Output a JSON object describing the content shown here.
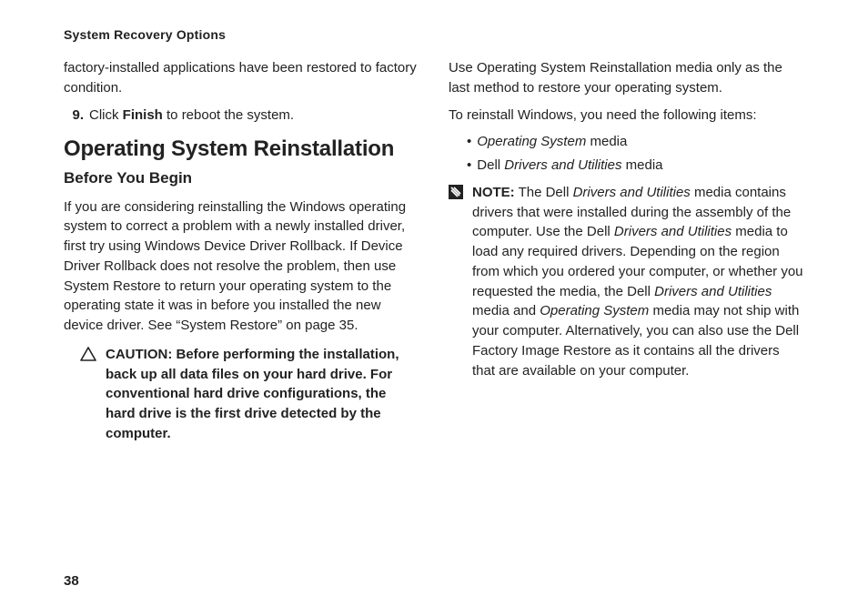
{
  "header": "System Recovery Options",
  "left": {
    "continued_text": "factory-installed applications have been restored to factory condition.",
    "step_number": "9.",
    "step_text_before": "Click ",
    "step_text_bold": "Finish",
    "step_text_after": " to reboot the system.",
    "h2": "Operating System Reinstallation",
    "h3": "Before You Begin",
    "para1": "If you are considering reinstalling the Windows operating system to correct a problem with a newly installed driver, first try using Windows Device Driver Rollback. If Device Driver Rollback does not resolve the problem, then use System Restore to return your operating system to the operating state it was in before you installed the new device driver. See “System Restore” on page 35.",
    "caution_text": "CAUTION: Before performing the installation, back up all data files on your hard drive. For conventional hard drive configurations, the hard drive is the first drive detected by the computer."
  },
  "right": {
    "para1": "Use Operating System Reinstallation media only as the last method to restore your operating system.",
    "para2": "To reinstall Windows, you need the following items:",
    "bullet1_italic": "Operating System",
    "bullet1_after": " media",
    "bullet2_before": "Dell ",
    "bullet2_italic": "Drivers and Utilities",
    "bullet2_after": " media",
    "note_label": "NOTE:",
    "note_s1_before": " The Dell ",
    "note_s1_italic": "Drivers and Utilities",
    "note_s1_after": " media contains drivers that were installed during the assembly of the computer. Use the Dell ",
    "note_s2_italic": "Drivers and Utilities",
    "note_s2_after": " media to load any required drivers. Depending on the region from which you ordered your computer, or whether you requested the media, the Dell ",
    "note_s3_italic": "Drivers and Utilities",
    "note_s3_after": " media and ",
    "note_s4_italic": "Operating System",
    "note_s4_after": " media may not ship with your computer. Alternatively, you can also use the Dell Factory Image Restore as it contains all the drivers that are available on your computer."
  },
  "page_number": "38"
}
